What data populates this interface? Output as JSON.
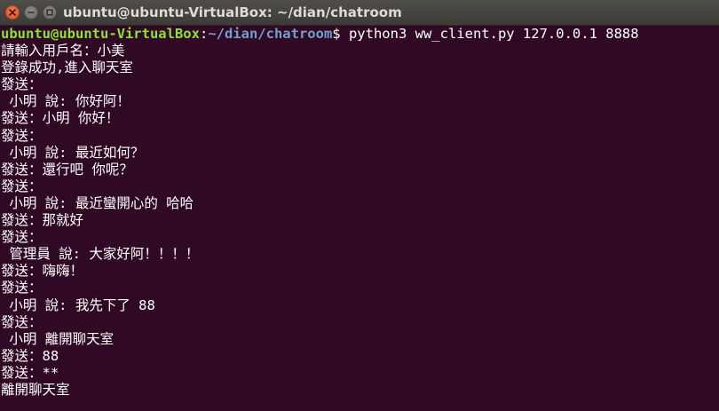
{
  "window": {
    "title": "ubuntu@ubuntu-VirtualBox: ~/dian/chatroom"
  },
  "terminal": {
    "prompt": {
      "user_host": "ubuntu@ubuntu-VirtualBox",
      "separator": ":",
      "path": "~/dian/chatroom",
      "symbol": "$ ",
      "command": "python3 ww_client.py 127.0.0.1 8888"
    },
    "lines": [
      "請輸入用戶名：小美",
      "登錄成功,進入聊天室",
      "發送：",
      " 小明 說: 你好阿！",
      "發送：小明 你好！",
      "發送：",
      " 小明 說: 最近如何？",
      "發送：還行吧 你呢？",
      "發送：",
      " 小明 說: 最近蠻開心的 哈哈",
      "發送：那就好",
      "發送：",
      " 管理員 說: 大家好阿！！！！",
      "發送：嗨嗨！",
      "發送：",
      " 小明 說: 我先下了 88",
      "發送：",
      " 小明 離開聊天室",
      "發送：88",
      "發送：**",
      "離開聊天室"
    ]
  },
  "colors": {
    "background": "#300a24",
    "prompt_user": "#8ae234",
    "prompt_path": "#729fcf",
    "text": "#ffffff",
    "close_button": "#e0531f"
  }
}
